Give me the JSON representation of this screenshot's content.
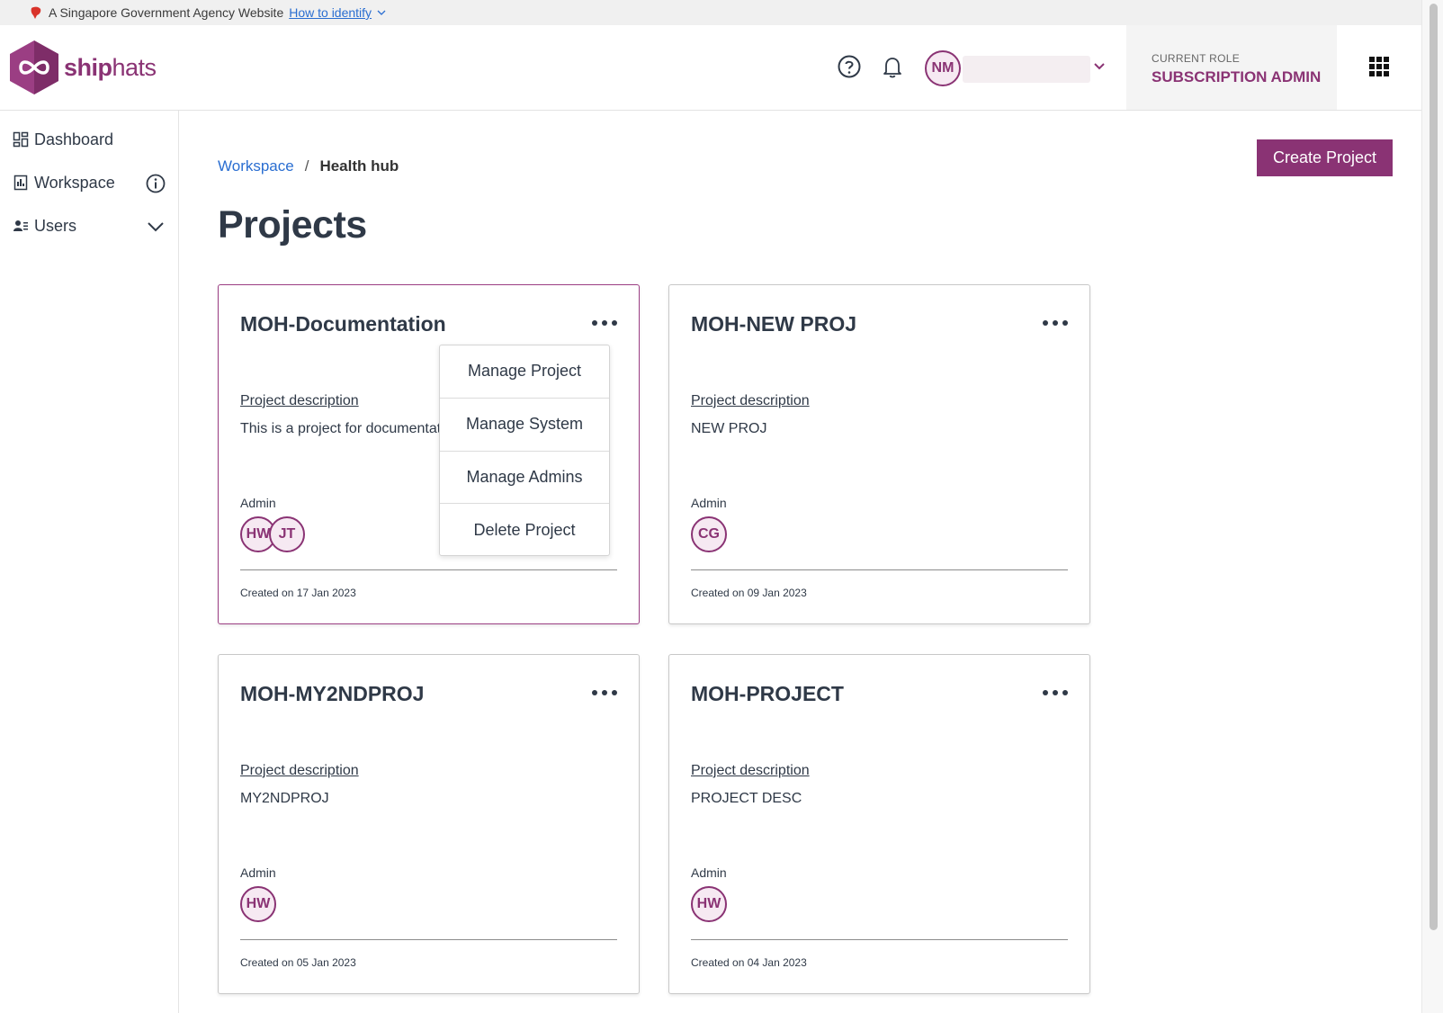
{
  "gov_banner": {
    "text": "A Singapore Government Agency Website",
    "link": "How to identify"
  },
  "header": {
    "logo_text_bold": "ship",
    "logo_text_rest": "hats",
    "user_initials": "NM",
    "role_label": "CURRENT ROLE",
    "role_value": "SUBSCRIPTION ADMIN",
    "icons": [
      "help-icon",
      "bell-icon",
      "chevron-down-icon",
      "apps-grid-icon"
    ]
  },
  "sidebar": {
    "items": [
      {
        "label": "Dashboard",
        "icon": "dashboard-icon"
      },
      {
        "label": "Workspace",
        "icon": "building-icon"
      },
      {
        "label": "Users",
        "icon": "users-icon"
      }
    ]
  },
  "breadcrumb": {
    "link": "Workspace",
    "separator": "/",
    "current": "Health hub"
  },
  "actions": {
    "create_project": "Create Project"
  },
  "page": {
    "title": "Projects"
  },
  "projects": [
    {
      "name": "MOH-Documentation",
      "desc_label": "Project description",
      "description": "This is a project for documentation",
      "admin_label": "Admin",
      "admins": [
        "HW",
        "JT"
      ],
      "created": "Created on 17 Jan 2023"
    },
    {
      "name": "MOH-NEW PROJ",
      "desc_label": "Project description",
      "description": "NEW PROJ",
      "admin_label": "Admin",
      "admins": [
        "CG"
      ],
      "created": "Created on 09 Jan 2023"
    },
    {
      "name": "MOH-MY2NDPROJ",
      "desc_label": "Project description",
      "description": "MY2NDPROJ",
      "admin_label": "Admin",
      "admins": [
        "HW"
      ],
      "created": "Created on 05 Jan 2023"
    },
    {
      "name": "MOH-PROJECT",
      "desc_label": "Project description",
      "description": "PROJECT DESC",
      "admin_label": "Admin",
      "admins": [
        "HW"
      ],
      "created": "Created on 04 Jan 2023"
    }
  ],
  "context_menu": {
    "items": [
      "Manage Project",
      "Manage System",
      "Manage Admins",
      "Delete Project"
    ]
  },
  "colors": {
    "brand": "#8a3374",
    "link": "#2a6ed1",
    "text": "#2f3947"
  }
}
